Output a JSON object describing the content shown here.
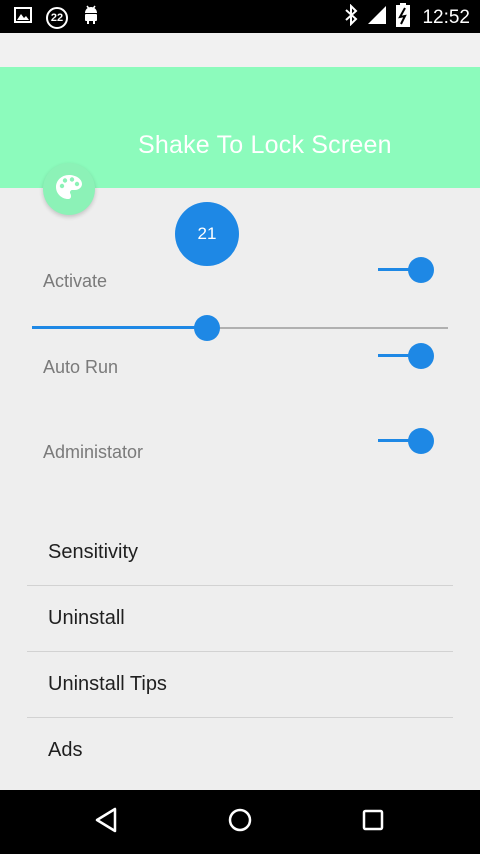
{
  "status_bar": {
    "notification_count": "22",
    "time": "12:52",
    "icons_left": [
      "image-icon",
      "notification-count-badge",
      "android-icon"
    ],
    "icons_right": [
      "bluetooth-icon",
      "cell-signal-icon",
      "battery-charging-icon"
    ]
  },
  "header": {
    "title": "Shake To Lock Screen",
    "background_color": "#8cfbbc",
    "fab_icon": "palette-icon"
  },
  "slider": {
    "bubble_value": "21",
    "value": 21,
    "max": 50,
    "accent_color": "#1e88e5"
  },
  "settings": [
    {
      "label": "Activate",
      "on": true
    },
    {
      "label": "Auto Run",
      "on": true
    },
    {
      "label": "Administator",
      "on": true
    }
  ],
  "menu": {
    "items": [
      {
        "label": "Sensitivity"
      },
      {
        "label": "Uninstall"
      },
      {
        "label": "Uninstall Tips"
      },
      {
        "label": "Ads"
      }
    ]
  },
  "nav_bar": {
    "buttons": [
      "back-icon",
      "home-icon",
      "recents-icon"
    ]
  }
}
